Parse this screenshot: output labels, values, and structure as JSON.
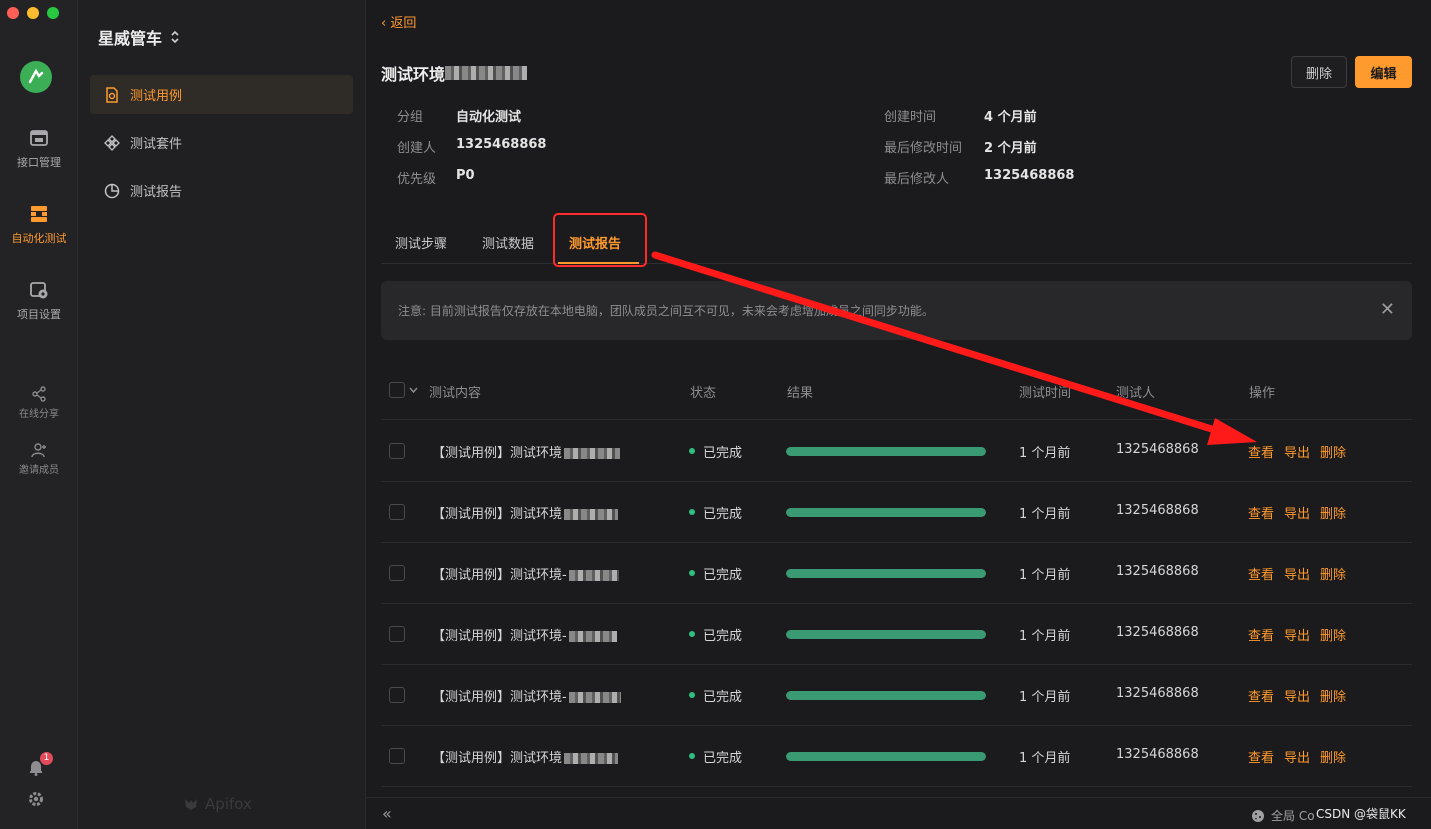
{
  "rail": {
    "items": [
      {
        "label": "接口管理",
        "icon": "api-icon"
      },
      {
        "label": "自动化测试",
        "icon": "automation-icon"
      },
      {
        "label": "项目设置",
        "icon": "project-settings-icon"
      },
      {
        "label": "在线分享",
        "icon": "share-icon"
      },
      {
        "label": "邀请成员",
        "icon": "invite-member-icon"
      }
    ],
    "notification_count": "1"
  },
  "sidebar": {
    "project_name": "星威管车",
    "items": [
      {
        "label": "测试用例",
        "icon": "test-case-icon"
      },
      {
        "label": "测试套件",
        "icon": "test-suite-icon"
      },
      {
        "label": "测试报告",
        "icon": "test-report-icon"
      }
    ],
    "brand": "Apifox"
  },
  "header": {
    "back_label": "返回",
    "title": "测试环境",
    "delete_label": "删除",
    "edit_label": "编辑"
  },
  "meta": {
    "group_label": "分组",
    "group_value": "自动化测试",
    "creator_label": "创建人",
    "creator_value": "1325468868",
    "priority_label": "优先级",
    "priority_value": "P0",
    "created_label": "创建时间",
    "created_value": "4 个月前",
    "modified_label": "最后修改时间",
    "modified_value": "2 个月前",
    "modifier_label": "最后修改人",
    "modifier_value": "1325468868"
  },
  "tabs": [
    {
      "label": "测试步骤"
    },
    {
      "label": "测试数据"
    },
    {
      "label": "测试报告"
    }
  ],
  "notice": "注意: 目前测试报告仅存放在本地电脑，团队成员之间互不可见，未来会考虑增加成员之间同步功能。",
  "table": {
    "headers": {
      "content": "测试内容",
      "status": "状态",
      "result": "结果",
      "time": "测试时间",
      "tester": "测试人",
      "actions": "操作"
    },
    "rows": [
      {
        "content": "【测试用例】测试环境",
        "status": "已完成",
        "progress": 1.0,
        "time": "1 个月前",
        "tester": "1325468868",
        "view": "查看",
        "export": "导出",
        "delete": "删除"
      },
      {
        "content": "【测试用例】测试环境",
        "status": "已完成",
        "progress": 1.0,
        "time": "1 个月前",
        "tester": "1325468868",
        "view": "查看",
        "export": "导出",
        "delete": "删除"
      },
      {
        "content": "【测试用例】测试环境-",
        "status": "已完成",
        "progress": 1.0,
        "time": "1 个月前",
        "tester": "1325468868",
        "view": "查看",
        "export": "导出",
        "delete": "删除"
      },
      {
        "content": "【测试用例】测试环境-",
        "status": "已完成",
        "progress": 1.0,
        "time": "1 个月前",
        "tester": "1325468868",
        "view": "查看",
        "export": "导出",
        "delete": "删除"
      },
      {
        "content": "【测试用例】测试环境-",
        "status": "已完成",
        "progress": 1.0,
        "time": "1 个月前",
        "tester": "1325468868",
        "view": "查看",
        "export": "导出",
        "delete": "删除"
      },
      {
        "content": "【测试用例】测试环境",
        "status": "已完成",
        "progress": 1.0,
        "time": "1 个月前",
        "tester": "1325468868",
        "view": "查看",
        "export": "导出",
        "delete": "删除"
      }
    ]
  },
  "footer": {
    "collapse_label": "«",
    "global_label": "全局 Co",
    "watermark": "CSDN @袋鼠KK"
  },
  "colors": {
    "accent": "#ff9a2e",
    "success": "#2fbf7f",
    "annotation": "#ff2a2a"
  }
}
